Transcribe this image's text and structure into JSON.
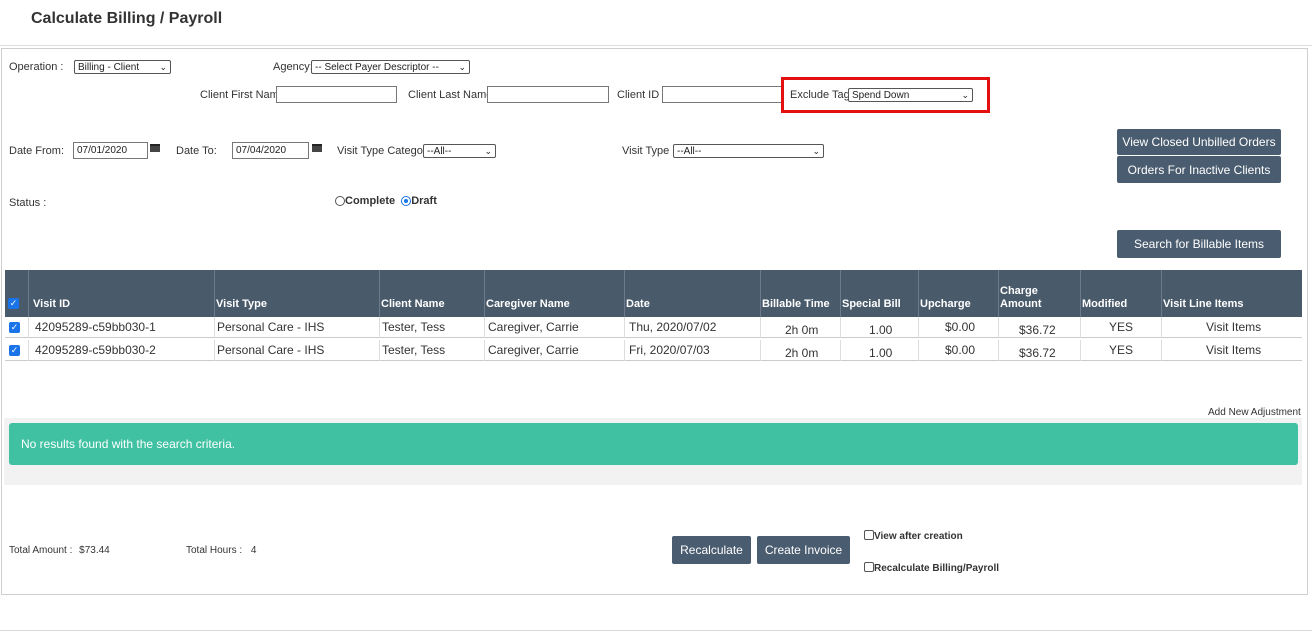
{
  "header": {
    "title": "Calculate Billing / Payroll"
  },
  "filters": {
    "operation_label": "Operation :",
    "operation_value": "Billing - Client",
    "agency_label": "Agency:",
    "agency_value": "-- Select Payer Descriptor --",
    "client_first_name_label": "Client First Name",
    "client_first_name_value": "",
    "client_last_name_label": "Client Last Name",
    "client_last_name_value": "",
    "client_id_label": "Client ID",
    "client_id_value": "",
    "exclude_tag_label": "Exclude Tag:",
    "exclude_tag_value": "Spend Down",
    "date_from_label": "Date From:",
    "date_from_value": "07/01/2020",
    "date_to_label": "Date To:",
    "date_to_value": "07/04/2020",
    "visit_type_category_label": "Visit Type Category",
    "visit_type_category_value": "--All--",
    "visit_type_label": "Visit Type",
    "visit_type_value": "--All--",
    "status_label": "Status :",
    "status_complete": "Complete",
    "status_draft": "Draft",
    "status_selected": "Draft"
  },
  "buttons": {
    "view_closed_unbilled": "View Closed Unbilled Orders",
    "orders_inactive": "Orders For Inactive Clients",
    "search_billable": "Search for Billable Items",
    "recalculate": "Recalculate",
    "create_invoice": "Create Invoice"
  },
  "table": {
    "columns": [
      "Visit ID",
      "Visit Type",
      "Client Name",
      "Caregiver Name",
      "Date",
      "Billable Time",
      "Special Bill",
      "Upcharge",
      "Charge Amount",
      "Modified",
      "Visit Line Items"
    ],
    "charge_line1": "Charge",
    "charge_line2": "Amount",
    "rows": [
      {
        "checked": true,
        "visit_id": "42095289-c59bb030-1",
        "visit_type": "Personal Care - IHS",
        "client_name": "Tester, Tess",
        "caregiver_name": "Caregiver, Carrie",
        "date": "Thu, 2020/07/02",
        "billable_time": "2h 0m",
        "special_bill": "1.00",
        "upcharge": "$0.00",
        "charge_amount": "$36.72",
        "modified": "YES",
        "visit_line_items": "Visit Items"
      },
      {
        "checked": true,
        "visit_id": "42095289-c59bb030-2",
        "visit_type": "Personal Care - IHS",
        "client_name": "Tester, Tess",
        "caregiver_name": "Caregiver, Carrie",
        "date": "Fri, 2020/07/03",
        "billable_time": "2h 0m",
        "special_bill": "1.00",
        "upcharge": "$0.00",
        "charge_amount": "$36.72",
        "modified": "YES",
        "visit_line_items": "Visit Items"
      }
    ]
  },
  "adjustment": {
    "add_link": "Add New Adjustment"
  },
  "alert": {
    "message": "No results found with the search criteria."
  },
  "totals": {
    "total_amount_label": "Total Amount :",
    "total_amount_value": "$73.44",
    "total_hours_label": "Total Hours :",
    "total_hours_value": "4"
  },
  "options": {
    "view_after_creation": "View after creation",
    "recalculate_billing_payroll": "Recalculate Billing/Payroll"
  },
  "colors": {
    "header_bg": "#495a6b",
    "button_bg": "#4a5c6f",
    "alert_bg": "#3fc1a2",
    "highlight": "#e31010",
    "checkbox": "#1a73e8"
  }
}
